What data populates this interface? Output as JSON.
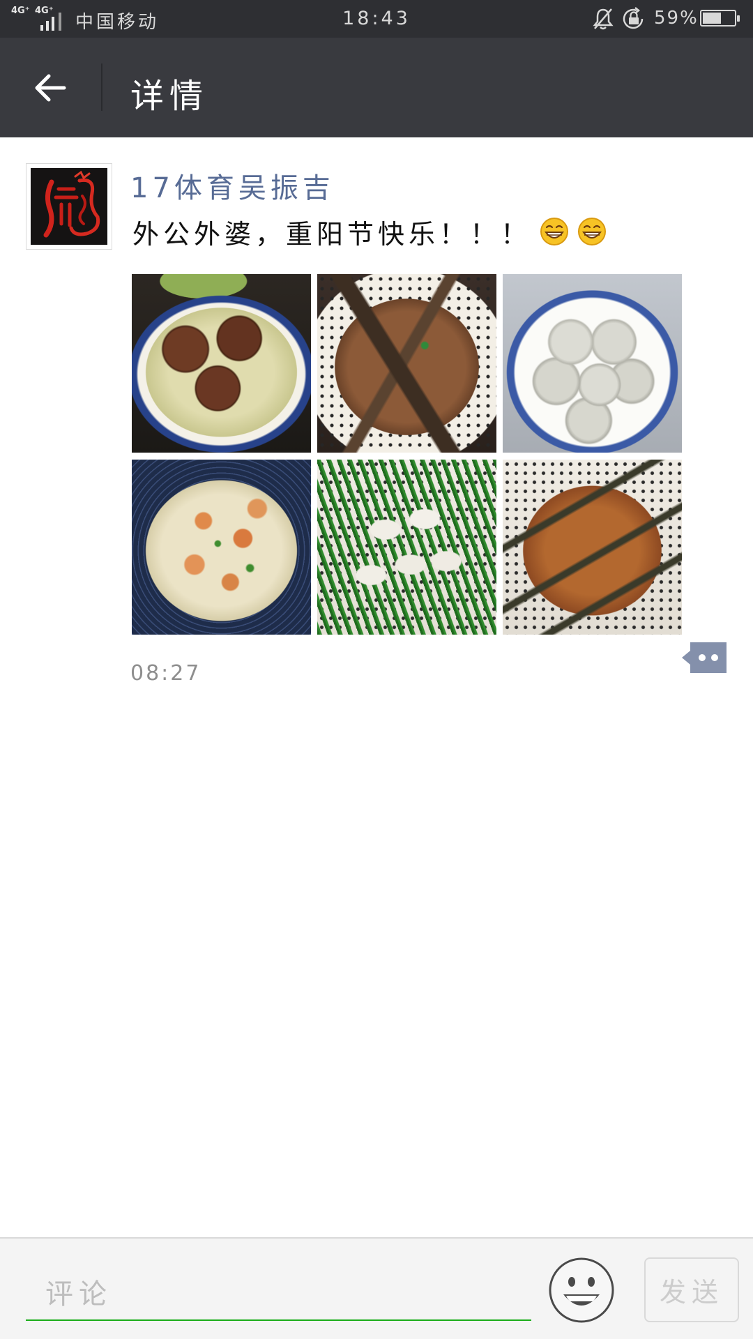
{
  "status_bar": {
    "network_1": "4G⁺",
    "network_2": "4G⁺",
    "carrier": "中国移动",
    "time": "18:43",
    "battery_text": "59%",
    "battery_level": 0.59,
    "icons": [
      "signal-icon",
      "mute-bell-icon",
      "rotation-lock-icon",
      "battery-icon"
    ]
  },
  "header": {
    "title": "详情",
    "back_icon": "arrow-left-icon"
  },
  "post": {
    "author": "17体育吴振吉",
    "text": "外公外婆，重阳节快乐！！！",
    "emojis": [
      "grin-emoji-icon",
      "grin-emoji-icon"
    ],
    "time": "08:27",
    "action_icon": "more-dots-icon"
  },
  "composer": {
    "placeholder": "评论",
    "send_label": "发送",
    "emoji_icon": "smiley-icon"
  },
  "colors": {
    "status_bar_bg": "#2e2f33",
    "header_bg": "#393a3f",
    "author_link": "#576b95",
    "input_underline": "#1aad19",
    "action_button": "#8490ab"
  }
}
